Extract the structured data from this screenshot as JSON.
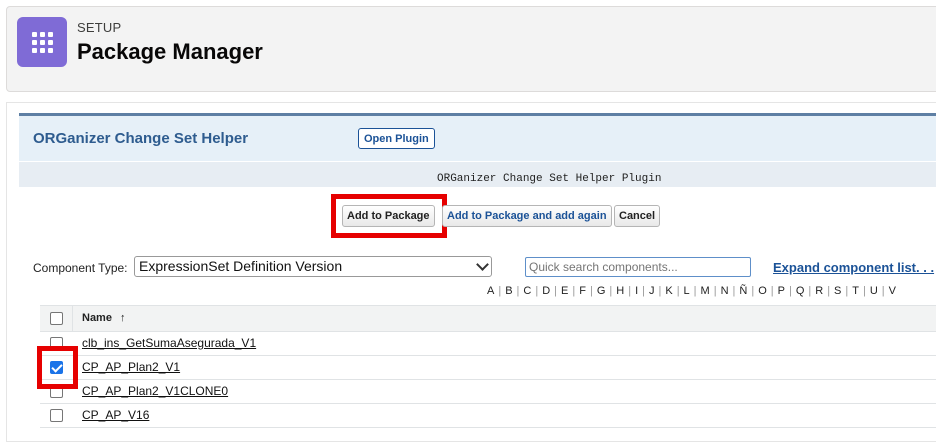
{
  "header": {
    "setup_label": "SETUP",
    "title": "Package Manager",
    "icon": "app-grid-icon"
  },
  "plugin": {
    "title": "ORGanizer Change Set Helper",
    "open_button": "Open Plugin",
    "subtitle": "ORGanizer Change Set Helper Plugin"
  },
  "actions": {
    "add": "Add to Package",
    "add_again": "Add to Package and add again",
    "cancel": "Cancel"
  },
  "filter": {
    "component_type_label": "Component Type:",
    "component_type_value": "ExpressionSet Definition Version",
    "search_placeholder": "Quick search components...",
    "expand_link": "Expand component list. . ."
  },
  "alphabet": [
    "A",
    "B",
    "C",
    "D",
    "E",
    "F",
    "G",
    "H",
    "I",
    "J",
    "K",
    "L",
    "M",
    "N",
    "Ñ",
    "O",
    "P",
    "Q",
    "R",
    "S",
    "T",
    "U",
    "V"
  ],
  "table": {
    "header_name": "Name",
    "sort_indicator": "↑",
    "rows": [
      {
        "name": "clb_ins_GetSumaAsegurada_V1",
        "checked": false
      },
      {
        "name": "CP_AP_Plan2_V1",
        "checked": true
      },
      {
        "name": "CP_AP_Plan2_V1CLONE0",
        "checked": false
      },
      {
        "name": "CP_AP_V16",
        "checked": false
      }
    ]
  },
  "colors": {
    "highlight": "#e60000",
    "app_icon": "#7f6bd6",
    "link": "#1b5297"
  }
}
